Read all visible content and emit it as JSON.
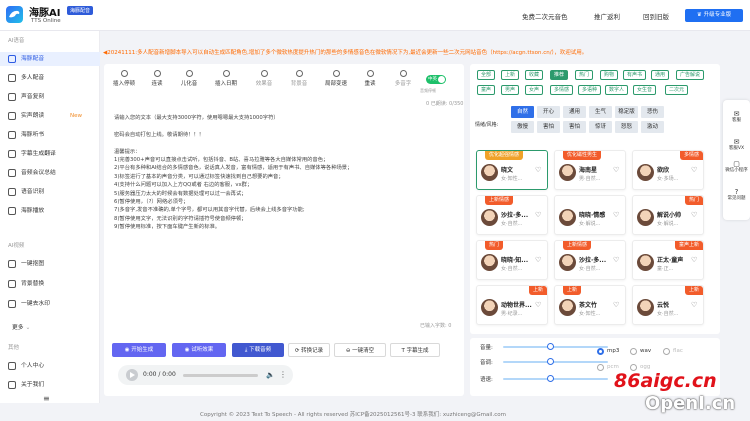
{
  "header": {
    "brand": "海豚AI",
    "badge": "海豚配音",
    "subtitle": "TTS Online",
    "nav": [
      "免费二次元音色",
      "推广返利",
      "回到旧版"
    ],
    "upgrade": "升级专业版"
  },
  "sidebar": {
    "section_main": "AI语音",
    "items": [
      {
        "label": "海豚配音"
      },
      {
        "label": "多人配音"
      },
      {
        "label": "声音复刻"
      },
      {
        "label": "实声朗读",
        "new": "New"
      },
      {
        "label": "海豚听书"
      },
      {
        "label": "字幕生成翻译"
      },
      {
        "label": "音频会议总结"
      },
      {
        "label": "语音识别"
      },
      {
        "label": "海豚播放"
      }
    ],
    "section_video": "AI视频",
    "items2": [
      {
        "label": "一键抠图"
      },
      {
        "label": "背景替换"
      },
      {
        "label": "一键去水印"
      }
    ],
    "more": "更多",
    "section_other": "其他",
    "items3": [
      {
        "label": "个人中心"
      },
      {
        "label": "关于我们"
      }
    ]
  },
  "notice": "◀20241111:多人配音新增脚本导入可以自动生成匹配角色,增加了多个微软热度提升热门的那些的多情感音色在微软情况下为,最近会更新一些二次元网站音色（https://acgn.ttson.cn/），欢迎试用。",
  "toolbar": [
    {
      "label": "插入停顿",
      "dim": false
    },
    {
      "label": "连读",
      "dim": false
    },
    {
      "label": "儿化音",
      "dim": false
    },
    {
      "label": "插入日期",
      "dim": false
    },
    {
      "label": "效果音",
      "dim": true
    },
    {
      "label": "背景音",
      "dim": true
    },
    {
      "label": "局部变速",
      "dim": false
    },
    {
      "label": "重读",
      "dim": false
    },
    {
      "label": "多音字",
      "dim": true
    }
  ],
  "editor": {
    "toggle_label": "中英",
    "pause_label": "音频停顿",
    "counter_top": "0 已朗读: 0/350",
    "counter_bottom": "已输入字数: 0",
    "lines": [
      "请输入您的文本（最大支持3000字符，使用嗯嗯最大支持1000字符）",
      "",
      "密码会自动打包上线。敬请期待！！！",
      "",
      "温馨提示：",
      "1)完善300+声音可以直接点击试听，包括抖音、B站、喜马拉雅等各大自媒体常用的音色；",
      "2)平台有多种和AI结合的多情感音色，说话真人发音，富有情感，适用于有声书、自媒体等各种场景；",
      "3)标签进行了基本的声音分类，可以通过标签快速找到自己想要的声音；",
      "4)支持什么问题可以加入上方QQ或者 右边的客服，vx群；",
      "5)服务器压力太大的时候会有数据处理可以过一会再试；",
      "6)暂停使用，（?）网络必须号；",
      "7)多音字,发音不准确的,单个字号，都可以用其音字代替，后续会上线多音字功能;",
      "8)暂停使用文字，无法识别的字符请插符号使音频停顿；",
      "9)暂停使用标准，按下面车键产生新的标准。"
    ]
  },
  "actions": {
    "generate": "开始生成",
    "preview": "试听效果",
    "download": "下载音频",
    "convert": "转换记录",
    "clear": "一键清空",
    "subtitle": "字幕生成"
  },
  "player": {
    "time": "0:00 / 0:00"
  },
  "filters": {
    "row1": [
      "全部",
      "上新",
      "收藏",
      "推荐",
      "热门",
      "购物",
      "有声书",
      "通用",
      "广告解说"
    ],
    "row1_selected": 3,
    "row2": [
      "童声",
      "男声",
      "女声",
      "多情感",
      "多语种",
      "数字人",
      "女生音",
      "二次元"
    ],
    "emotion_label": "情绪/风格:",
    "emotions": [
      [
        "自然",
        "开心",
        "通用",
        "生气",
        "稳定版",
        "悲伤"
      ],
      [
        "傲慢",
        "害怕",
        "害怕",
        "惊讶",
        "怒怒",
        "激动"
      ]
    ]
  },
  "voices": [
    {
      "name": "晓文",
      "desc": "女·知性...",
      "lb": "优化超强情感",
      "rb": "",
      "sel": true
    },
    {
      "name": "海南星",
      "desc": "男·自然...",
      "lb": "优化磁性男生",
      "rb": "",
      "sel": false
    },
    {
      "name": "欲欣",
      "desc": "女·多场...",
      "lb": "",
      "rb": "多情感",
      "sel": false
    },
    {
      "name": "沙拉·多...",
      "desc": "女·自然...",
      "lb": "上新情感",
      "rb": "",
      "sel": false
    },
    {
      "name": "晓晓·情感",
      "desc": "女·解说...",
      "lb": "",
      "rb": "",
      "sel": false
    },
    {
      "name": "解说小帅",
      "desc": "女·解说...",
      "lb": "",
      "rb": "热门",
      "sel": false
    },
    {
      "name": "晓晓·知...",
      "desc": "女·自然...",
      "lb": "热门",
      "rb": "",
      "sel": false
    },
    {
      "name": "沙拉·多...",
      "desc": "女·自然...",
      "lb": "上新情感",
      "rb": "",
      "sel": false
    },
    {
      "name": "正太·童声",
      "desc": "童·正...",
      "lb": "",
      "rb": "童声上新",
      "sel": false
    },
    {
      "name": "动物世界...",
      "desc": "男·纪录...",
      "lb": "",
      "rb": "上新",
      "sel": false
    },
    {
      "name": "茶文竹",
      "desc": "女·知性...",
      "lb": "上新",
      "rb": "",
      "sel": false
    },
    {
      "name": "云悦",
      "desc": "女·自然...",
      "lb": "",
      "rb": "上新",
      "sel": false
    }
  ],
  "settings": {
    "volume_label": "音量:",
    "pitch_label": "音调:",
    "speed_label": "语速:",
    "volume": 0.45,
    "pitch": 0.45,
    "speed": 0.45,
    "formats": [
      "mp3",
      "wav",
      "flac"
    ],
    "format_selected": 0,
    "extras": [
      "pcm",
      "ogg"
    ]
  },
  "floating": [
    {
      "glyph": "✉",
      "label": "客服"
    },
    {
      "glyph": "✉",
      "label": "客服VX"
    },
    {
      "glyph": "▢",
      "label": "微信小程序"
    },
    {
      "glyph": "?",
      "label": "常见问题"
    }
  ],
  "footer": "Copyright © 2023 Text To Speech - All rights reserved  苏ICP备2025012561号-3  联系我们: xuzhiceng@Gmail.com",
  "watermark": {
    "site1": "86aigc.cn",
    "site2": "OpenI.cn"
  },
  "colors": {
    "accent": "#1f6ff2",
    "green": "#2c9a6c",
    "orange": "#f25c2b",
    "notice": "#ff6a00"
  }
}
